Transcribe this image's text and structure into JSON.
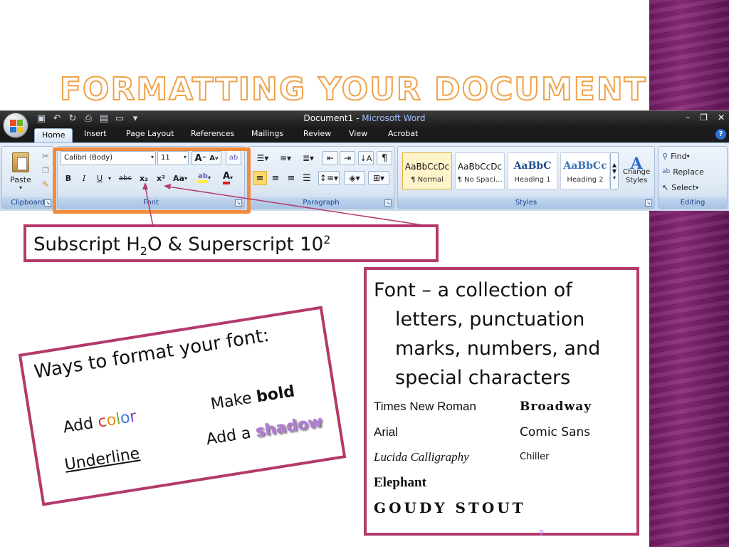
{
  "slide": {
    "title": "Formatting Your Document",
    "number": "9"
  },
  "colors": {
    "accent_orange": "#f38b3c",
    "callout_border": "#b33a6b",
    "side_band": "#7a2070",
    "shadow_text": "#b27ad8"
  },
  "word": {
    "window_title": "Document1",
    "window_title_sep": " - ",
    "app_name": "Microsoft Word",
    "window_controls": [
      "–",
      "❐",
      "✕"
    ],
    "tabs": [
      "Home",
      "Insert",
      "Page Layout",
      "References",
      "Mailings",
      "Review",
      "View",
      "Acrobat"
    ],
    "active_tab": "Home",
    "clipboard": {
      "label": "Clipboard",
      "paste_label": "Paste"
    },
    "font": {
      "label": "Font",
      "font_name": "Calibri (Body)",
      "font_size": "11",
      "bold": "B",
      "italic": "I",
      "underline": "U",
      "strikethrough": "abc",
      "subscript": "x₂",
      "superscript": "x²",
      "change_case": "Aa",
      "grow": "A",
      "shrink": "A"
    },
    "paragraph": {
      "label": "Paragraph"
    },
    "styles": {
      "label": "Styles",
      "items": [
        {
          "sample": "AaBbCcDc",
          "name": "¶ Normal"
        },
        {
          "sample": "AaBbCcDc",
          "name": "¶ No Spaci..."
        },
        {
          "sample": "AaBbC",
          "name": "Heading 1"
        },
        {
          "sample": "AaBbCc",
          "name": "Heading 2"
        }
      ],
      "change_styles_line1": "Change",
      "change_styles_line2": "Styles"
    },
    "editing": {
      "label": "Editing",
      "find": "Find",
      "replace": "Replace",
      "select": "Select"
    }
  },
  "subscript_callout": {
    "part1": "Subscript H",
    "sub": "2",
    "part2": "O & Superscript 10",
    "sup": "2"
  },
  "ways_card": {
    "title": "Ways to format your font:",
    "add_label": "Add ",
    "color_letters": [
      {
        "ch": "c",
        "color": "#d9351e"
      },
      {
        "ch": "o",
        "color": "#e88a1a"
      },
      {
        "ch": "l",
        "color": "#6bb02f"
      },
      {
        "ch": "o",
        "color": "#3b7bd6"
      },
      {
        "ch": "r",
        "color": "#8a3ab9"
      }
    ],
    "make_label": "Make ",
    "bold_word": "bold",
    "underline": "Underline",
    "add_a_label": "Add a ",
    "shadow_word": "shadow"
  },
  "font_card": {
    "definition_line1": "Font – a collection of",
    "definition_rest": [
      "letters, punctuation",
      "marks, numbers, and",
      "special characters"
    ],
    "samples": [
      {
        "text": "Times New Roman",
        "style": "serif"
      },
      {
        "text": "Broadway",
        "style": "broadway"
      },
      {
        "text": "Arial",
        "style": "sans"
      },
      {
        "text": "Comic Sans",
        "style": "comic"
      },
      {
        "text": "Lucida Calligraphy",
        "style": "calligraphy"
      },
      {
        "text": "Chiller",
        "style": "chiller"
      },
      {
        "text": "Elephant",
        "style": "elephant"
      },
      {
        "text": "GOUDY STOUT",
        "style": "goudy"
      }
    ]
  }
}
